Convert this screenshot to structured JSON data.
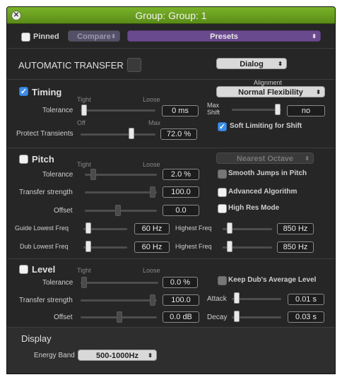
{
  "window": {
    "title": "Group: Group: 1"
  },
  "toolbar": {
    "pinned": "Pinned",
    "compare": "Compare",
    "presets": "Presets"
  },
  "auto": {
    "title": "AUTOMATIC TRANSFER",
    "dialog": "Dialog"
  },
  "timing": {
    "label": "Timing",
    "checked": true,
    "alignment_label": "Alignment",
    "alignment": "Normal Flexibility",
    "tight": "Tight",
    "loose": "Loose",
    "tolerance_label": "Tolerance",
    "tolerance": "0 ms",
    "off": "Off",
    "max": "Max",
    "protect_label": "Protect Transients",
    "protect": "72.0 %",
    "max_shift_label": "Max\nShift",
    "max_shift": "no",
    "soft_limiting": "Soft Limiting for Shift"
  },
  "pitch": {
    "label": "Pitch",
    "checked": false,
    "octave": "Nearest Octave",
    "tight": "Tight",
    "loose": "Loose",
    "tolerance_label": "Tolerance",
    "tolerance": "2.0 %",
    "transfer_label": "Transfer strength",
    "transfer": "100.0",
    "offset_label": "Offset",
    "offset": "0.0",
    "smooth": "Smooth Jumps in Pitch",
    "advanced": "Advanced Algorithm",
    "highres": "High Res Mode",
    "guide_low_label": "Guide Lowest Freq",
    "guide_low": "60 Hz",
    "guide_high_label": "Highest Freq",
    "guide_high": "850 Hz",
    "dub_low_label": "Dub Lowest Freq",
    "dub_low": "60 Hz",
    "dub_high_label": "Highest Freq",
    "dub_high": "850 Hz"
  },
  "level": {
    "label": "Level",
    "checked": false,
    "tight": "Tight",
    "loose": "Loose",
    "tolerance_label": "Tolerance",
    "tolerance": "0.0 %",
    "keep": "Keep Dub's Average Level",
    "transfer_label": "Transfer strength",
    "transfer": "100.0",
    "attack_label": "Attack",
    "attack": "0.01 s",
    "offset_label": "Offset",
    "offset": "0.0 dB",
    "decay_label": "Decay",
    "decay": "0.03 s"
  },
  "display": {
    "title": "Display",
    "energy_label": "Energy Band",
    "energy": "500-1000Hz"
  },
  "colors": {
    "titlebar": "#6ea126",
    "accent": "#3d8ee8",
    "presets": "#6a4a8e"
  }
}
